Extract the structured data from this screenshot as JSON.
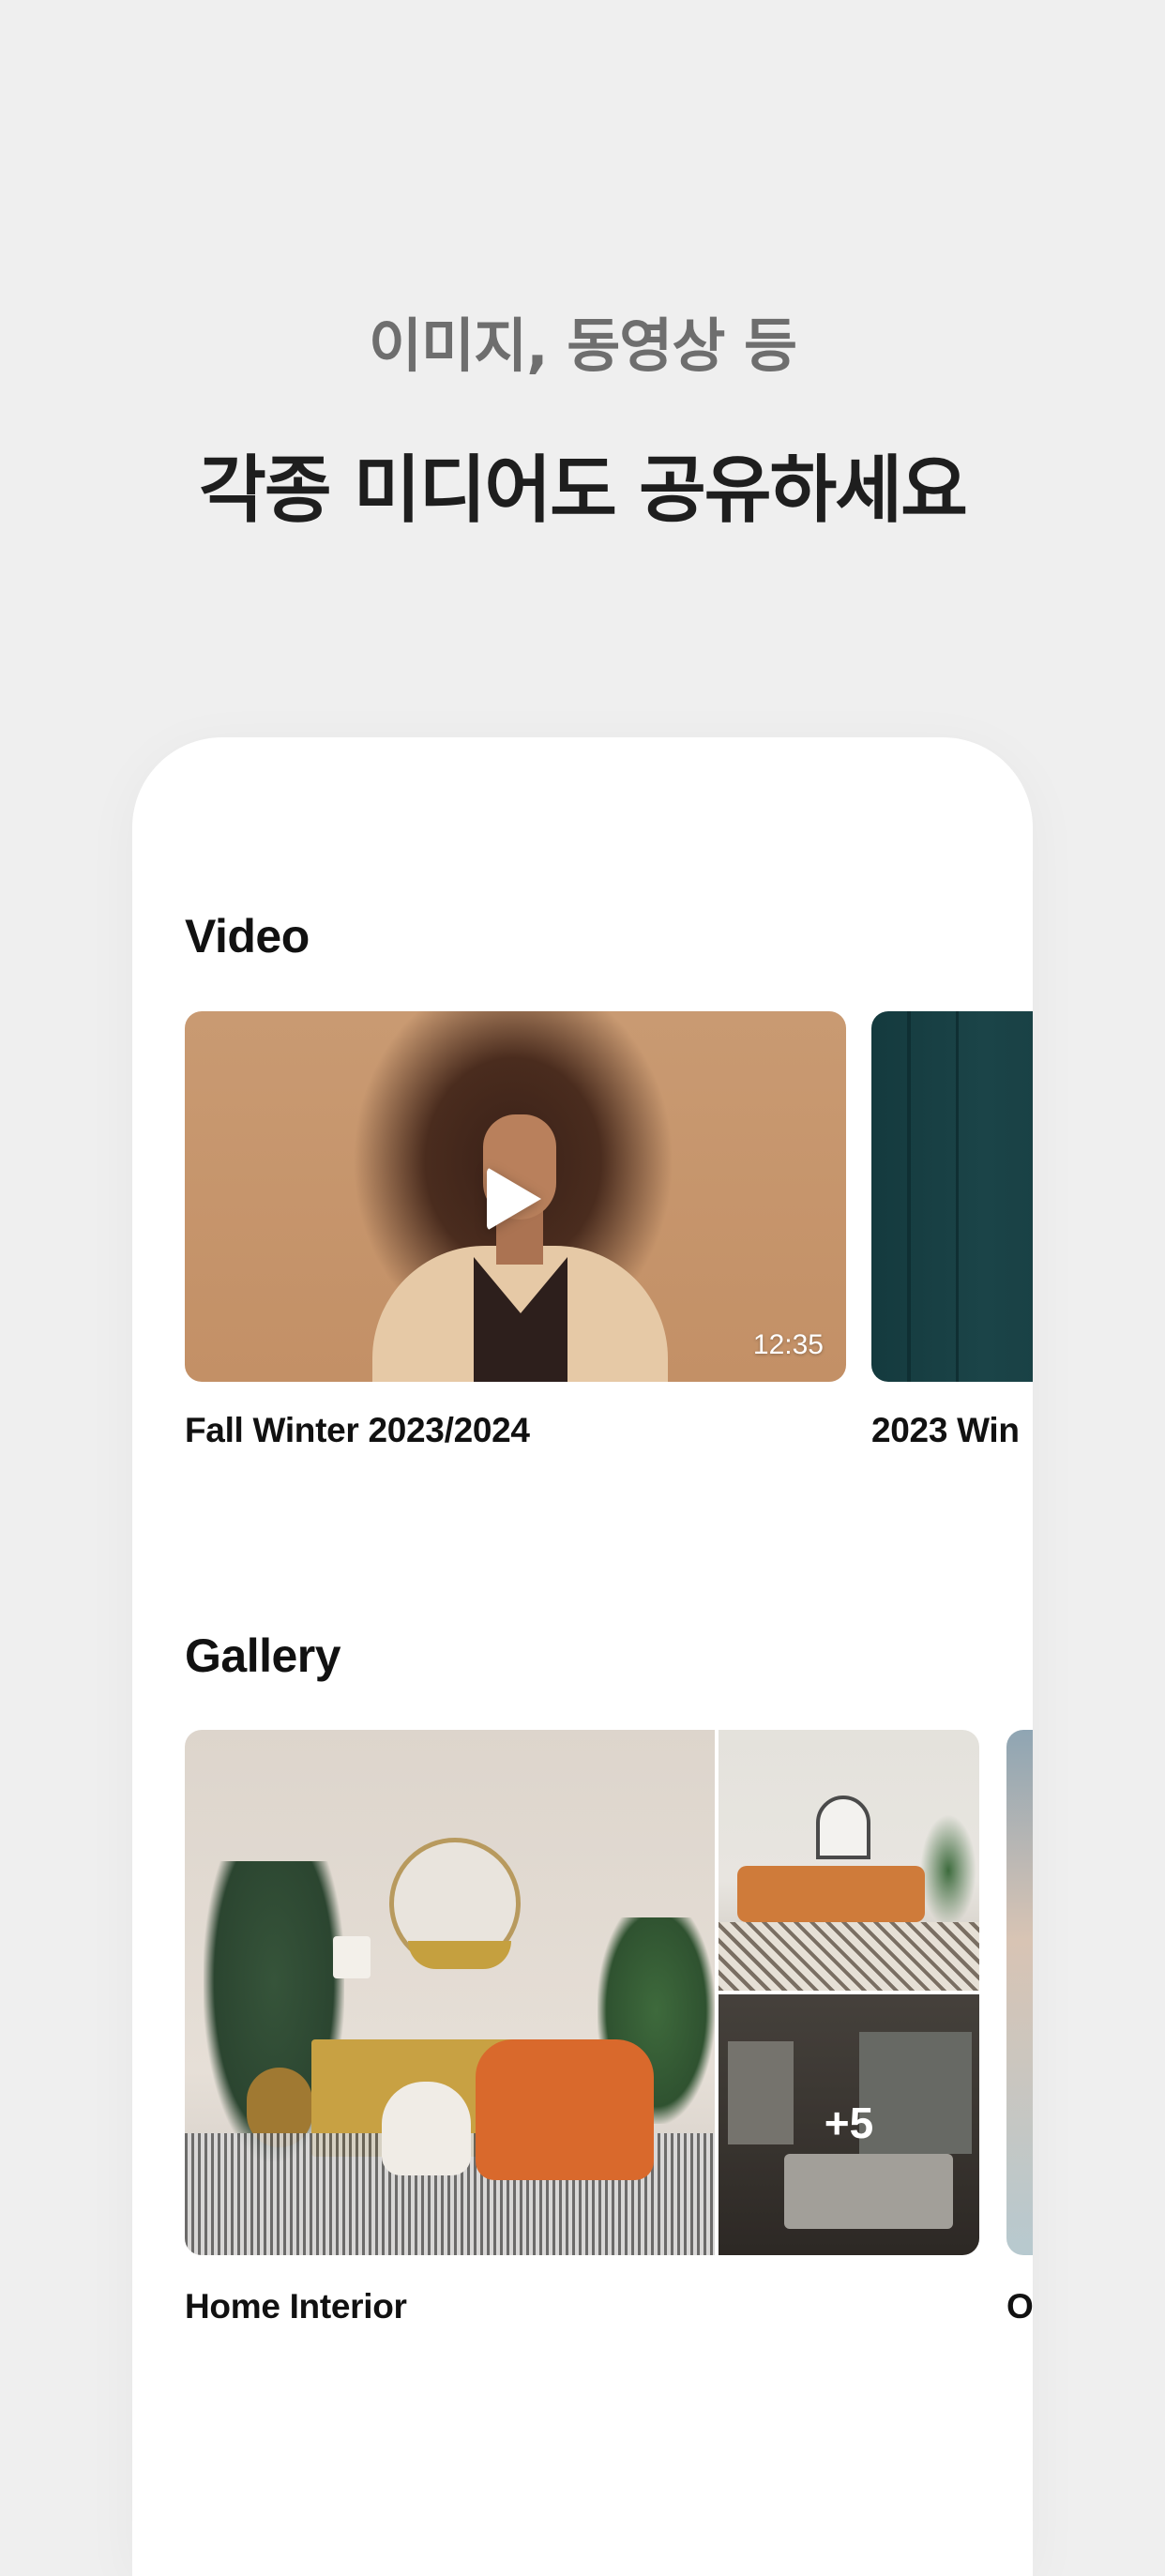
{
  "header": {
    "subtitle": "이미지, 동영상 등",
    "title": "각종 미디어도 공유하세요"
  },
  "video_section": {
    "title": "Video",
    "cards": [
      {
        "caption": "Fall Winter 2023/2024",
        "duration": "12:35",
        "image": "woman-curly-hair-portrait"
      },
      {
        "caption": "2023 Win",
        "image": "dark-teal-wall"
      }
    ]
  },
  "gallery_section": {
    "title": "Gallery",
    "cards": [
      {
        "caption": "Home Interior",
        "more_count": "+5",
        "images": [
          "living-room-orange-chair",
          "living-room-sofa",
          "bedroom"
        ]
      },
      {
        "caption": "O"
      }
    ]
  },
  "colors": {
    "background": "#efefef",
    "card": "#ffffff",
    "subtitle_text": "#6e6e6e",
    "title_text": "#1e1e1e"
  }
}
